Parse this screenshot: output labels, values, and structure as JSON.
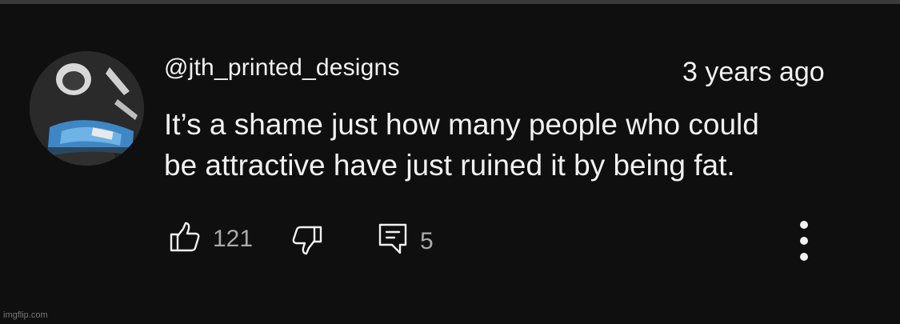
{
  "comment": {
    "username": "@jth_printed_designs",
    "timestamp": "3 years ago",
    "text_line1": "It’s a shame just how many people who could",
    "text_line2": "be attractive have just ruined it by being fat.",
    "avatar_icon": "avatar-photo",
    "likes": "121",
    "replies": "5"
  },
  "icons": {
    "like": "thumbs-up-icon",
    "dislike": "thumbs-down-icon",
    "reply": "reply-icon",
    "more": "more-vertical-icon"
  },
  "watermark": "imgflip.com",
  "colors": {
    "background": "#0f0f0f",
    "primary_text": "#f1f1f1",
    "secondary_text": "#aaaaaa"
  }
}
